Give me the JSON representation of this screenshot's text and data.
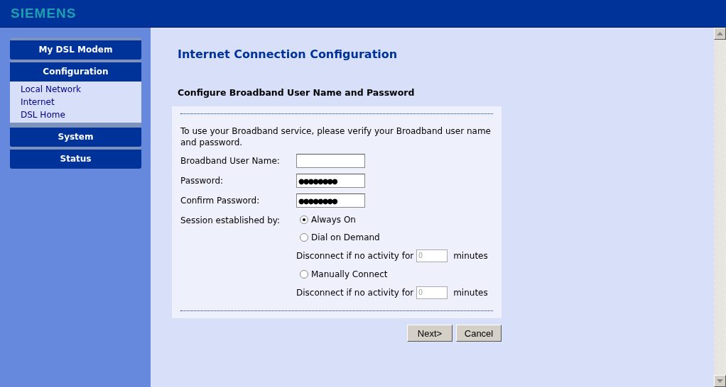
{
  "header": {
    "logo": "SIEMENS"
  },
  "sidebar": {
    "sections": [
      {
        "label": "My DSL Modem",
        "expanded": false
      },
      {
        "label": "Configuration",
        "expanded": true,
        "items": [
          {
            "label": "Local Network"
          },
          {
            "label": "Internet"
          },
          {
            "label": "DSL Home"
          }
        ]
      },
      {
        "label": "System",
        "expanded": false
      },
      {
        "label": "Status",
        "expanded": false
      }
    ]
  },
  "page_title": "Internet Connection Configuration",
  "section_title": "Configure Broadband User Name and Password",
  "intro": "To use your Broadband service, please verify your Broadband user name and password.",
  "fields": [
    {
      "label": "Broadband User Name:"
    },
    {
      "label": "Password:",
      "value": "●●●●●●●●"
    },
    {
      "label": "Confirm Password:",
      "value": "●●●●●●●●"
    }
  ],
  "session": {
    "label": "Session established by:",
    "options": [
      {
        "kind": "radio",
        "label": "Always On",
        "selected": true
      },
      {
        "kind": "radio",
        "label": "Dial on Demand",
        "selected": false
      },
      {
        "kind": "timeout",
        "label": "Disconnect if no activity for",
        "value": "0",
        "unit": "minutes",
        "disabled": true
      },
      {
        "kind": "radio",
        "label": "Manually Connect",
        "selected": false
      },
      {
        "kind": "timeout",
        "label": "Disconnect if no activity for",
        "value": "0",
        "unit": "minutes",
        "disabled": true
      }
    ]
  },
  "buttons": [
    {
      "label": "Next>"
    },
    {
      "label": "Cancel"
    }
  ]
}
